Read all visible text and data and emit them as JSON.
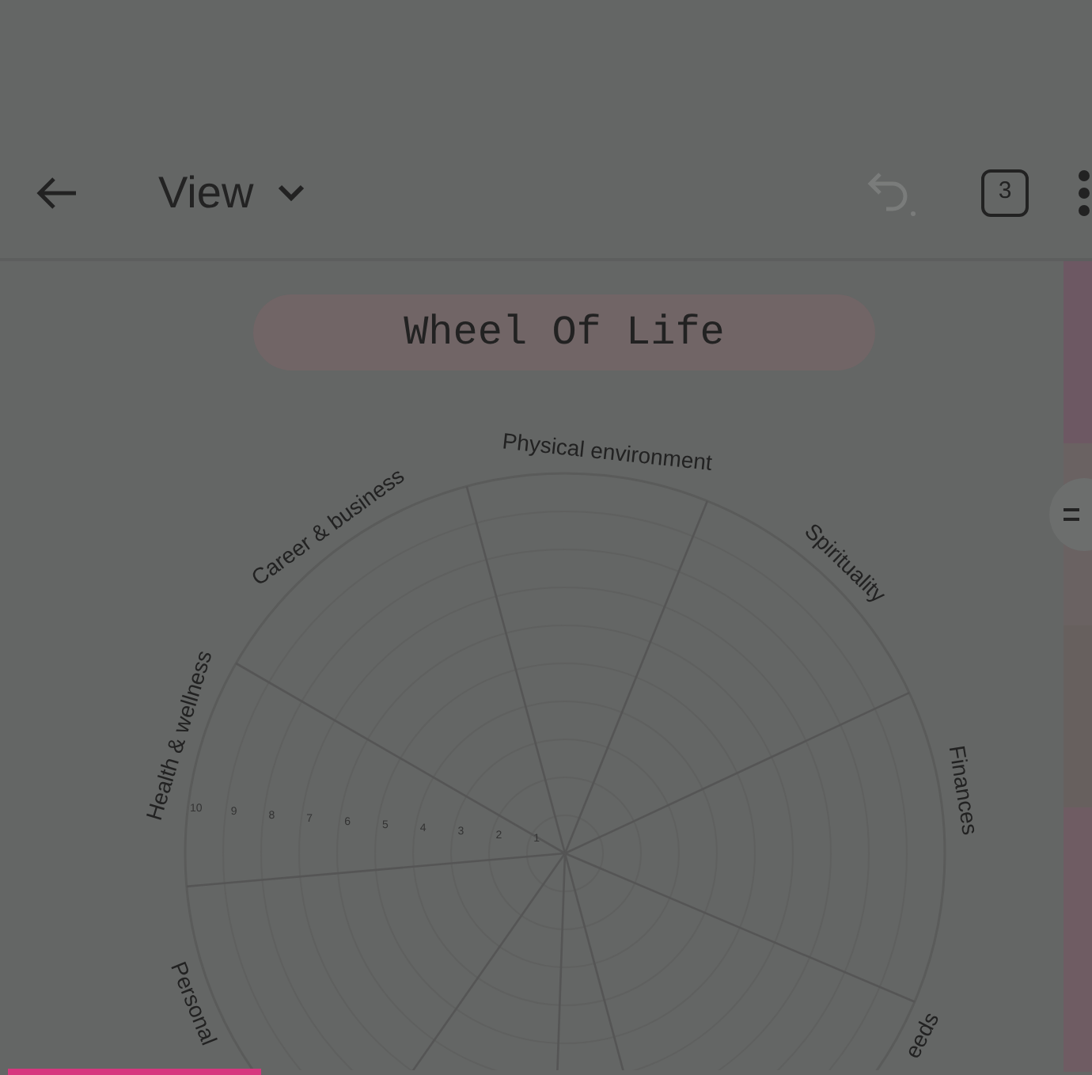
{
  "toolbar": {
    "title": "View",
    "page_count": "3",
    "undo": {
      "disabled": true
    }
  },
  "document": {
    "title": "Wheel Of Life",
    "wheel": {
      "labels": [
        "Physical environment",
        "Spirituality",
        "Finances",
        "eeds",
        "Personal",
        "Health & wellness",
        "Career & business"
      ],
      "scale": [
        "10",
        "9",
        "8",
        "7",
        "6",
        "5",
        "4",
        "3",
        "2",
        "1"
      ]
    }
  }
}
